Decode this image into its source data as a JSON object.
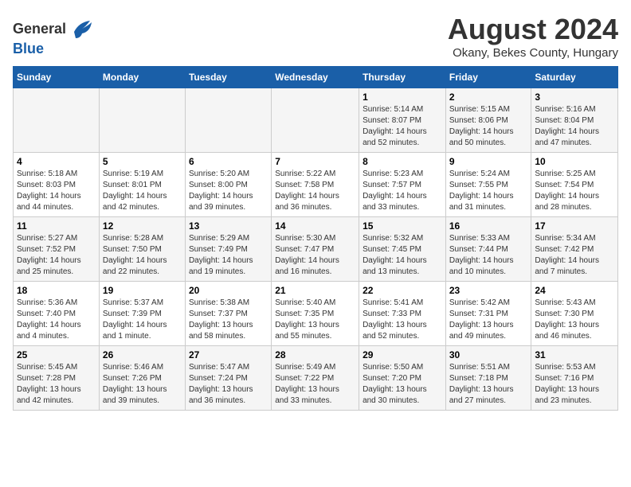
{
  "header": {
    "logo_general": "General",
    "logo_blue": "Blue",
    "month_year": "August 2024",
    "location": "Okany, Bekes County, Hungary"
  },
  "days_of_week": [
    "Sunday",
    "Monday",
    "Tuesday",
    "Wednesday",
    "Thursday",
    "Friday",
    "Saturday"
  ],
  "weeks": [
    [
      {
        "day": "",
        "info": ""
      },
      {
        "day": "",
        "info": ""
      },
      {
        "day": "",
        "info": ""
      },
      {
        "day": "",
        "info": ""
      },
      {
        "day": "1",
        "info": "Sunrise: 5:14 AM\nSunset: 8:07 PM\nDaylight: 14 hours\nand 52 minutes."
      },
      {
        "day": "2",
        "info": "Sunrise: 5:15 AM\nSunset: 8:06 PM\nDaylight: 14 hours\nand 50 minutes."
      },
      {
        "day": "3",
        "info": "Sunrise: 5:16 AM\nSunset: 8:04 PM\nDaylight: 14 hours\nand 47 minutes."
      }
    ],
    [
      {
        "day": "4",
        "info": "Sunrise: 5:18 AM\nSunset: 8:03 PM\nDaylight: 14 hours\nand 44 minutes."
      },
      {
        "day": "5",
        "info": "Sunrise: 5:19 AM\nSunset: 8:01 PM\nDaylight: 14 hours\nand 42 minutes."
      },
      {
        "day": "6",
        "info": "Sunrise: 5:20 AM\nSunset: 8:00 PM\nDaylight: 14 hours\nand 39 minutes."
      },
      {
        "day": "7",
        "info": "Sunrise: 5:22 AM\nSunset: 7:58 PM\nDaylight: 14 hours\nand 36 minutes."
      },
      {
        "day": "8",
        "info": "Sunrise: 5:23 AM\nSunset: 7:57 PM\nDaylight: 14 hours\nand 33 minutes."
      },
      {
        "day": "9",
        "info": "Sunrise: 5:24 AM\nSunset: 7:55 PM\nDaylight: 14 hours\nand 31 minutes."
      },
      {
        "day": "10",
        "info": "Sunrise: 5:25 AM\nSunset: 7:54 PM\nDaylight: 14 hours\nand 28 minutes."
      }
    ],
    [
      {
        "day": "11",
        "info": "Sunrise: 5:27 AM\nSunset: 7:52 PM\nDaylight: 14 hours\nand 25 minutes."
      },
      {
        "day": "12",
        "info": "Sunrise: 5:28 AM\nSunset: 7:50 PM\nDaylight: 14 hours\nand 22 minutes."
      },
      {
        "day": "13",
        "info": "Sunrise: 5:29 AM\nSunset: 7:49 PM\nDaylight: 14 hours\nand 19 minutes."
      },
      {
        "day": "14",
        "info": "Sunrise: 5:30 AM\nSunset: 7:47 PM\nDaylight: 14 hours\nand 16 minutes."
      },
      {
        "day": "15",
        "info": "Sunrise: 5:32 AM\nSunset: 7:45 PM\nDaylight: 14 hours\nand 13 minutes."
      },
      {
        "day": "16",
        "info": "Sunrise: 5:33 AM\nSunset: 7:44 PM\nDaylight: 14 hours\nand 10 minutes."
      },
      {
        "day": "17",
        "info": "Sunrise: 5:34 AM\nSunset: 7:42 PM\nDaylight: 14 hours\nand 7 minutes."
      }
    ],
    [
      {
        "day": "18",
        "info": "Sunrise: 5:36 AM\nSunset: 7:40 PM\nDaylight: 14 hours\nand 4 minutes."
      },
      {
        "day": "19",
        "info": "Sunrise: 5:37 AM\nSunset: 7:39 PM\nDaylight: 14 hours\nand 1 minute."
      },
      {
        "day": "20",
        "info": "Sunrise: 5:38 AM\nSunset: 7:37 PM\nDaylight: 13 hours\nand 58 minutes."
      },
      {
        "day": "21",
        "info": "Sunrise: 5:40 AM\nSunset: 7:35 PM\nDaylight: 13 hours\nand 55 minutes."
      },
      {
        "day": "22",
        "info": "Sunrise: 5:41 AM\nSunset: 7:33 PM\nDaylight: 13 hours\nand 52 minutes."
      },
      {
        "day": "23",
        "info": "Sunrise: 5:42 AM\nSunset: 7:31 PM\nDaylight: 13 hours\nand 49 minutes."
      },
      {
        "day": "24",
        "info": "Sunrise: 5:43 AM\nSunset: 7:30 PM\nDaylight: 13 hours\nand 46 minutes."
      }
    ],
    [
      {
        "day": "25",
        "info": "Sunrise: 5:45 AM\nSunset: 7:28 PM\nDaylight: 13 hours\nand 42 minutes."
      },
      {
        "day": "26",
        "info": "Sunrise: 5:46 AM\nSunset: 7:26 PM\nDaylight: 13 hours\nand 39 minutes."
      },
      {
        "day": "27",
        "info": "Sunrise: 5:47 AM\nSunset: 7:24 PM\nDaylight: 13 hours\nand 36 minutes."
      },
      {
        "day": "28",
        "info": "Sunrise: 5:49 AM\nSunset: 7:22 PM\nDaylight: 13 hours\nand 33 minutes."
      },
      {
        "day": "29",
        "info": "Sunrise: 5:50 AM\nSunset: 7:20 PM\nDaylight: 13 hours\nand 30 minutes."
      },
      {
        "day": "30",
        "info": "Sunrise: 5:51 AM\nSunset: 7:18 PM\nDaylight: 13 hours\nand 27 minutes."
      },
      {
        "day": "31",
        "info": "Sunrise: 5:53 AM\nSunset: 7:16 PM\nDaylight: 13 hours\nand 23 minutes."
      }
    ]
  ]
}
